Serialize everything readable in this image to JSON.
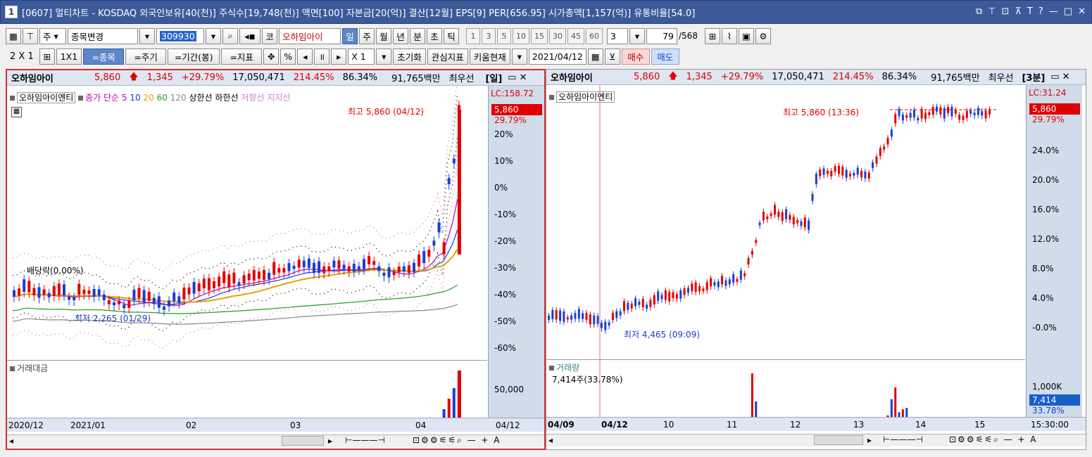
{
  "window": {
    "number": "1",
    "title": "[0607] 멀티차트 - KOSDAQ 외국인보유[40(천)] 주식수[19,748(천)] 액면[100] 자본금[20(억)] 결산[12월] EPS[9] PER[656.95] 시가총액[1,157(억)] 유통비율[54.0]",
    "buttons": [
      "⧉",
      "⊤",
      "⊡",
      "⊼",
      "T",
      "?",
      "—",
      "□",
      "✕"
    ]
  },
  "toolbar1": {
    "market": "주",
    "change_stock": "종목변경",
    "code": "309930",
    "type": "코",
    "stock_name": "오하임아이",
    "periods": [
      "일",
      "주",
      "월",
      "년",
      "분",
      "초",
      "틱"
    ],
    "active_period": "일",
    "intervals": [
      "1",
      "3",
      "5",
      "10",
      "15",
      "30",
      "45",
      "60"
    ],
    "interval_value": "3",
    "page_pos": "79",
    "page_total": "/568"
  },
  "toolbar2": {
    "layout": "2 X 1",
    "onebyone": "1X1",
    "by_stock": "=종목",
    "by_period": "=주기",
    "by_range": "=기간(봉)",
    "by_indicator": "=지표",
    "percent": "%",
    "multiplier": "X 1",
    "reset": "초기화",
    "watch": "관심지표",
    "kiwoom": "키움현재",
    "date": "2021/04/12",
    "buy": "매수",
    "sell": "매도"
  },
  "left_chart": {
    "name": "오하임아이",
    "price": "5,860",
    "change": "1,345",
    "change_pct": "+29.79%",
    "volume": "17,050,471",
    "vol_ratio": "214.45%",
    "ratio2": "86.34%",
    "amount": "91,765백만",
    "priority": "최우선",
    "period_tag": "[일]",
    "legend_stock": "오하임아이엔티",
    "legend_ma": "종가 단순",
    "ma_periods": [
      "5",
      "10",
      "20",
      "60",
      "120"
    ],
    "legend_upper": "상한선",
    "legend_lower": "하한선",
    "legend_resist": "저항선",
    "legend_support": "지지선",
    "high_label": "최고 5,860 (04/12)",
    "low_label": "최저 2,265 (01/29)",
    "dividend": "배당락(0.00%)",
    "lc": "LC:158.72",
    "axis_price": "5,860",
    "axis_pct": "29.79%",
    "y_ticks": [
      "20%",
      "10%",
      "0%",
      "-10%",
      "-20%",
      "-30%",
      "-40%",
      "-50%",
      "-60%"
    ],
    "vol_title": "거래대금",
    "vol_tick": "50,000",
    "x_labels": [
      "2020/12",
      "2021/01",
      "02",
      "03",
      "04"
    ],
    "x_end": "04/12"
  },
  "right_chart": {
    "name": "오하임아이",
    "price": "5,860",
    "change": "1,345",
    "change_pct": "+29.79%",
    "volume": "17,050,471",
    "vol_ratio": "214.45%",
    "ratio2": "86.34%",
    "amount": "91,765백만",
    "priority": "최우선",
    "period_tag": "[3분]",
    "legend_stock": "오하임아이엔티",
    "high_label": "최고 5,860 (13:36)",
    "low_label": "최저 4,465 (09:09)",
    "lc": "LC:31.24",
    "axis_price": "5,860",
    "axis_pct": "29.79%",
    "y_ticks": [
      "24.0%",
      "20.0%",
      "16.0%",
      "12.0%",
      "8.0%",
      "4.0%",
      "-0.0%"
    ],
    "vol_title": "거래량",
    "vol_note": "7,414주(33.78%)",
    "vol_tick": "1,000K",
    "vol_box": "7,414",
    "vol_pct": "33.78%",
    "x_labels": [
      "04/09",
      "04/12",
      "10",
      "11",
      "12",
      "13",
      "14",
      "15"
    ],
    "x_end": "15:30:00"
  }
}
